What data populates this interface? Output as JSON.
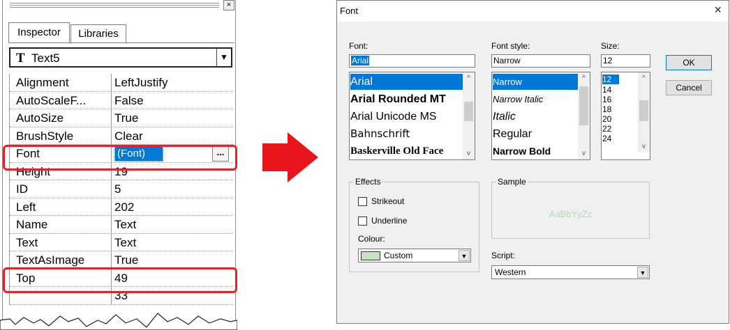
{
  "inspector": {
    "close_glyph": "×",
    "tabs": [
      "Inspector",
      "Libraries"
    ],
    "object_selector": {
      "icon": "T",
      "value": "Text5",
      "arrow": "▼"
    },
    "properties": [
      {
        "name": "Alignment",
        "value": "LeftJustify"
      },
      {
        "name": "AutoScaleF...",
        "value": "False"
      },
      {
        "name": "AutoSize",
        "value": "True"
      },
      {
        "name": "BrushStyle",
        "value": "Clear"
      },
      {
        "name": "Font",
        "value": "(Font)",
        "button": "..."
      },
      {
        "name": "Height",
        "value": "19"
      },
      {
        "name": "ID",
        "value": "5"
      },
      {
        "name": "Left",
        "value": "202"
      },
      {
        "name": "Name",
        "value": "Text"
      },
      {
        "name": "Text",
        "value": "Text"
      },
      {
        "name": "TextAsImage",
        "value": "True"
      },
      {
        "name": "Top",
        "value": "49"
      },
      {
        "name": "",
        "value": "33"
      }
    ]
  },
  "arrow_color": "#e8161a",
  "highlight_color": "#e8202a",
  "font_dialog": {
    "title": "Font",
    "close": "×",
    "font": {
      "label": "Font:",
      "value": "Arial",
      "items": [
        "Arial",
        "Arial Rounded MT",
        "Arial Unicode MS",
        "Bahnschrift",
        "Baskerville Old Face"
      ],
      "selected": "Arial"
    },
    "font_style": {
      "label": "Font style:",
      "value": "Narrow",
      "items": [
        "Narrow",
        "Narrow Italic",
        "Italic",
        "Regular",
        "Narrow Bold"
      ],
      "selected": "Narrow"
    },
    "size": {
      "label": "Size:",
      "value": "12",
      "items": [
        "12",
        "14",
        "16",
        "18",
        "20",
        "22",
        "24"
      ],
      "selected": "12"
    },
    "ok_label": "OK",
    "cancel_label": "Cancel",
    "effects": {
      "label": "Effects",
      "strikeout": "Strikeout",
      "underline": "Underline",
      "colour_label": "Colour:",
      "colour_value": "Custom",
      "colour_swatch": "#c9e2c6"
    },
    "sample": {
      "label": "Sample",
      "text": "AaBbYyZz",
      "color": "#b5d8b2"
    },
    "script": {
      "label": "Script:",
      "value": "Western"
    }
  }
}
